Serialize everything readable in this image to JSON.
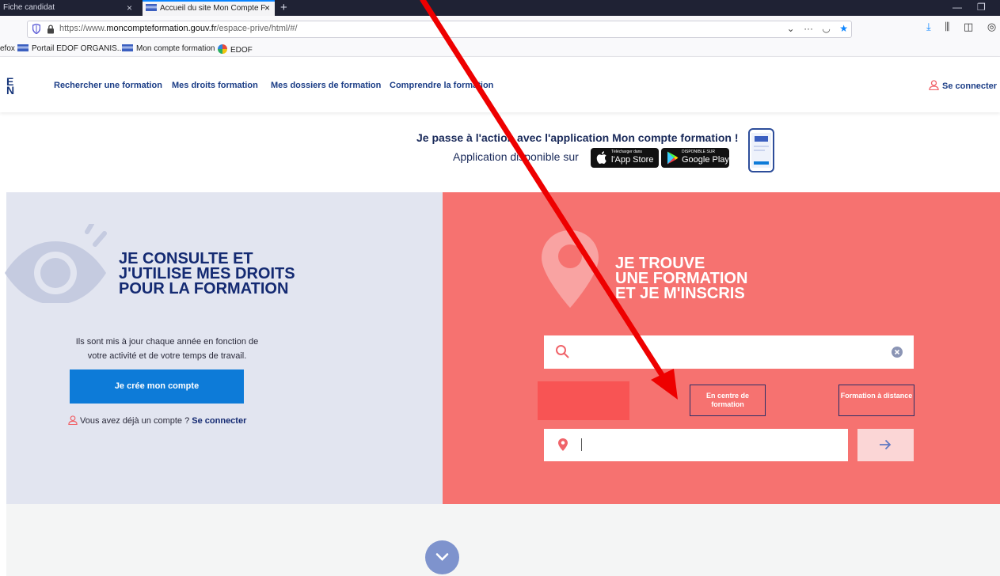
{
  "browser": {
    "tabs": [
      {
        "label": "Fiche candidat"
      },
      {
        "label": "Accueil du site Mon Compte F"
      }
    ],
    "new_tab_glyph": "+",
    "url_prefix": "https://www.",
    "url_domain": "moncompteformation.gouv.fr",
    "url_path": "/espace-prive/html/#/",
    "bookmarks_stub": "efox",
    "bookmarks": [
      "Portail EDOF ORGANIS...",
      "Mon compte formation",
      "EDOF"
    ]
  },
  "header": {
    "logo_stub_1": "E",
    "logo_stub_2": "N",
    "nav": [
      "Rechercher une formation",
      "Mes droits formation",
      "Mes dossiers de formation",
      "Comprendre la formation"
    ],
    "login_label": "Se connecter"
  },
  "promo": {
    "title": "Je passe à l'action avec l'application Mon compte formation !",
    "subtitle": "Application disponible sur",
    "appstore_small": "Télécharger dans",
    "appstore_big": "l'App Store",
    "gplay_small": "DISPONIBLE SUR",
    "gplay_big": "Google Play"
  },
  "left_panel": {
    "title_lines": [
      "JE CONSULTE ET",
      "J'UTILISE MES DROITS",
      "POUR LA FORMATION"
    ],
    "description": "Ils sont mis à jour chaque année en fonction de votre activité et de votre temps de travail.",
    "create_button": "Je crée mon compte",
    "login_prompt": "Vous avez déjà un compte ?",
    "login_link": "Se connecter"
  },
  "right_panel": {
    "title_lines": [
      "JE TROUVE",
      "UNE FORMATION",
      "ET JE M'INSCRIS"
    ],
    "search_value": "",
    "mode_centre": "En centre de formation",
    "mode_distance": "Formation à distance",
    "location_value": ""
  },
  "colors": {
    "navy": "#1b3d86",
    "left_bg": "#e2e5f0",
    "right_bg": "#f67270",
    "create_btn": "#0d7bd8",
    "annotation_arrow": "#ee0000"
  },
  "icons": [
    "shield-icon",
    "lock-icon",
    "star-icon",
    "download-icon",
    "person-icon",
    "eye-icon",
    "map-pin-icon",
    "search-icon",
    "clear-icon",
    "arrow-right-icon",
    "chevron-down-icon",
    "apple-icon",
    "google-play-icon",
    "phone-icon"
  ]
}
